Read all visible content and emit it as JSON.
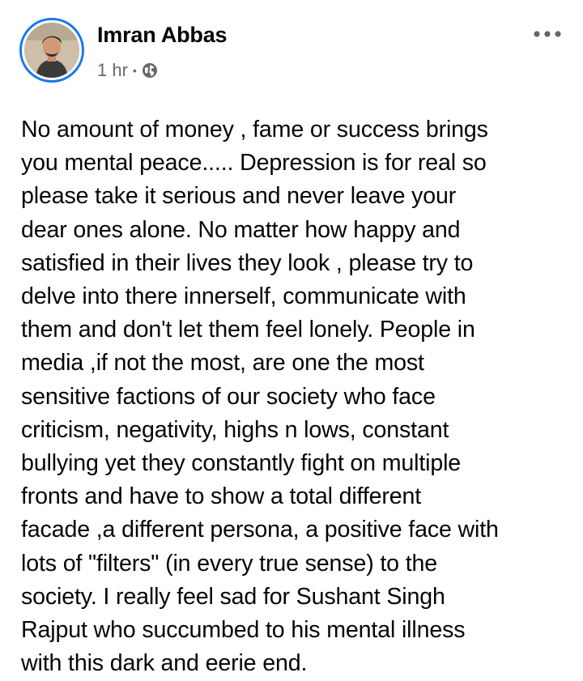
{
  "post": {
    "author": "Imran Abbas",
    "timestamp": "1 hr",
    "separator": "•",
    "privacy_icon": "globe-icon",
    "more_icon": "more-horizontal-icon",
    "text": "No amount of money , fame or success brings\nyou mental peace..... Depression is for real so\nplease take it serious and never leave your\ndear ones alone. No matter how happy and\nsatisfied in their lives they look , please try to\ndelve into there innerself, communicate with\nthem and don't let them feel lonely. People in\nmedia ,if not the most, are one the most\nsensitive factions of our society who face\ncriticism,  negativity,  highs n lows, constant\nbullying yet they constantly fight on multiple\nfronts and have to show a total different\nfacade ,a different persona, a positive face with\nlots of \"filters\" (in every true sense) to the\nsociety. I really feel sad for Sushant Singh\nRajput who succumbed to his mental illness\nwith this dark and eerie end."
  },
  "colors": {
    "accent": "#1877f2",
    "name": "#050505",
    "meta": "#65676b",
    "text": "#050505"
  }
}
